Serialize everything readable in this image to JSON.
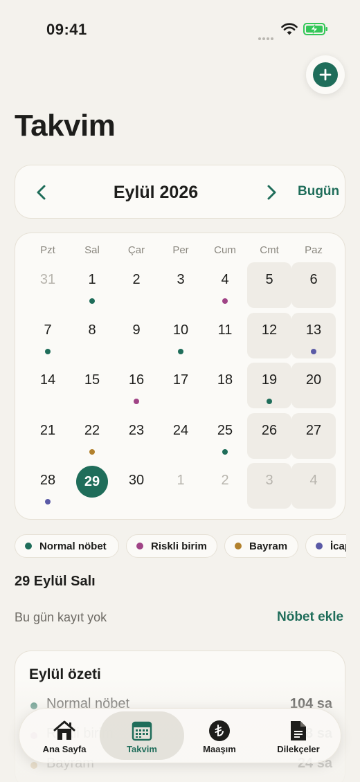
{
  "status_bar": {
    "time": "09:41"
  },
  "header": {
    "title": "Takvim"
  },
  "month_nav": {
    "label": "Eylül 2026",
    "today_label": "Bugün"
  },
  "calendar": {
    "weekdays": [
      "Pzt",
      "Sal",
      "Çar",
      "Per",
      "Cum",
      "Cmt",
      "Paz"
    ],
    "weeks": [
      [
        {
          "d": "31",
          "muted": true
        },
        {
          "d": "1",
          "dot": "normal"
        },
        {
          "d": "2"
        },
        {
          "d": "3"
        },
        {
          "d": "4",
          "dot": "risk"
        },
        {
          "d": "5"
        },
        {
          "d": "6"
        }
      ],
      [
        {
          "d": "7",
          "dot": "normal"
        },
        {
          "d": "8"
        },
        {
          "d": "9"
        },
        {
          "d": "10",
          "dot": "normal"
        },
        {
          "d": "11"
        },
        {
          "d": "12"
        },
        {
          "d": "13",
          "dot": "icap"
        }
      ],
      [
        {
          "d": "14"
        },
        {
          "d": "15"
        },
        {
          "d": "16",
          "dot": "risk"
        },
        {
          "d": "17"
        },
        {
          "d": "18"
        },
        {
          "d": "19",
          "dot": "normal"
        },
        {
          "d": "20"
        }
      ],
      [
        {
          "d": "21"
        },
        {
          "d": "22",
          "dot": "bayram"
        },
        {
          "d": "23"
        },
        {
          "d": "24"
        },
        {
          "d": "25",
          "dot": "normal"
        },
        {
          "d": "26"
        },
        {
          "d": "27"
        }
      ],
      [
        {
          "d": "28",
          "dot": "icap"
        },
        {
          "d": "29",
          "selected": true
        },
        {
          "d": "30"
        },
        {
          "d": "1",
          "muted": true
        },
        {
          "d": "2",
          "muted": true
        },
        {
          "d": "3",
          "muted": true
        },
        {
          "d": "4",
          "muted": true
        }
      ]
    ]
  },
  "colors": {
    "accent": "#1f6d5a",
    "normal": "#1f6d5a",
    "risk": "#a04386",
    "bayram": "#b2812d",
    "icap": "#5a5aa6"
  },
  "legend": [
    {
      "key": "normal",
      "label": "Normal nöbet"
    },
    {
      "key": "risk",
      "label": "Riskli birim"
    },
    {
      "key": "bayram",
      "label": "Bayram"
    },
    {
      "key": "icap",
      "label": "İcap"
    }
  ],
  "selected_day": {
    "title": "29 Eylül Salı",
    "empty_text": "Bu gün kayıt yok",
    "add_label": "Nöbet ekle"
  },
  "summary": {
    "title": "Eylül özeti",
    "rows": [
      {
        "key": "normal",
        "label": "Normal nöbet",
        "value": "104 sa"
      },
      {
        "key": "risk",
        "label": "Riskli birim",
        "value": "48 sa"
      },
      {
        "key": "bayram",
        "label": "Bayram",
        "value": "24 sa"
      }
    ]
  },
  "tabs": [
    {
      "label": "Ana Sayfa",
      "icon": "home-icon",
      "active": false
    },
    {
      "label": "Takvim",
      "icon": "calendar-icon",
      "active": true
    },
    {
      "label": "Maaşım",
      "icon": "lira-icon",
      "active": false
    },
    {
      "label": "Dilekçeler",
      "icon": "document-icon",
      "active": false
    }
  ]
}
